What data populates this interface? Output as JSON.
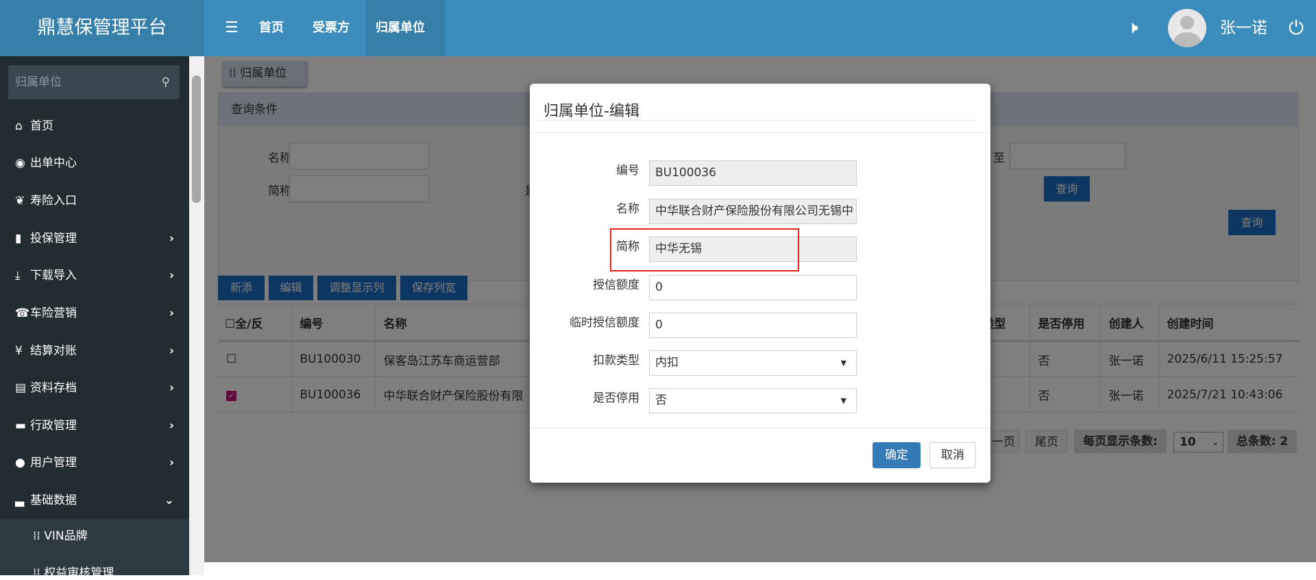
{
  "app": {
    "title": "鼎慧保管理平台"
  },
  "topnav": {
    "menu_icon": "☰",
    "items": [
      "首页",
      "受票方",
      "归属单位"
    ],
    "user": "张一诺"
  },
  "sidebar": {
    "search_placeholder": "归属单位",
    "items": [
      {
        "label": "首页",
        "icon": "home"
      },
      {
        "label": "出单中心",
        "icon": "globe"
      },
      {
        "label": "寿险入口",
        "icon": "leaf"
      },
      {
        "label": "投保管理",
        "icon": "file"
      },
      {
        "label": "下载导入",
        "icon": "download"
      },
      {
        "label": "车险营销",
        "icon": "phone"
      },
      {
        "label": "结算对账",
        "icon": "yen"
      },
      {
        "label": "资料存档",
        "icon": "list"
      },
      {
        "label": "行政管理",
        "icon": "folder"
      },
      {
        "label": "用户管理",
        "icon": "user"
      },
      {
        "label": "基础数据",
        "icon": "hdd"
      }
    ],
    "sub_items": [
      "VIN品牌",
      "权益审核管理"
    ]
  },
  "page": {
    "tab": "归属单位",
    "query_title": "查询条件",
    "filters": {
      "name_label": "名称",
      "short_label": "简称",
      "partial_label": "是",
      "to_label": "至",
      "query": "查询",
      "query2": "查询"
    },
    "toolbar": [
      "新添",
      "编辑",
      "调整显示列",
      "保存列宽"
    ],
    "table": {
      "headers": [
        "全/反",
        "编号",
        "名称",
        "类型",
        "是否停用",
        "创建人",
        "创建时间"
      ],
      "rows": [
        {
          "id": "BU100030",
          "name": "保客岛江苏车商运营部",
          "disabled": "否",
          "creator": "张一诺",
          "created": "2025/6/11 15:25:57",
          "checked": false
        },
        {
          "id": "BU100036",
          "name": "中华联合财产保险股份有限",
          "disabled": "否",
          "creator": "张一诺",
          "created": "2025/7/21 10:43:06",
          "checked": true
        }
      ]
    },
    "pagination": {
      "prev": "一页",
      "last": "尾页",
      "per_page_label": "每页显示条数:",
      "per_page": "10",
      "total": "总条数: 2"
    }
  },
  "dialog": {
    "title": "归属单位-编辑",
    "fields": [
      {
        "label": "编号",
        "value": "BU100036"
      },
      {
        "label": "名称",
        "value": "中华联合财产保险股份有限公司无锡中"
      },
      {
        "label": "简称",
        "value": "中华无锡"
      },
      {
        "label": "授信额度",
        "value": "0"
      },
      {
        "label": "临时授信额度",
        "value": "0"
      },
      {
        "label": "扣款类型",
        "value": "内扣"
      },
      {
        "label": "是否停用",
        "value": "否"
      }
    ],
    "ok": "确定",
    "cancel": "取消"
  },
  "colors": {
    "header": "#3c8dbc",
    "sidebar": "#222d32",
    "primary": "#1a6fc4",
    "highlight": "#e8211d"
  }
}
